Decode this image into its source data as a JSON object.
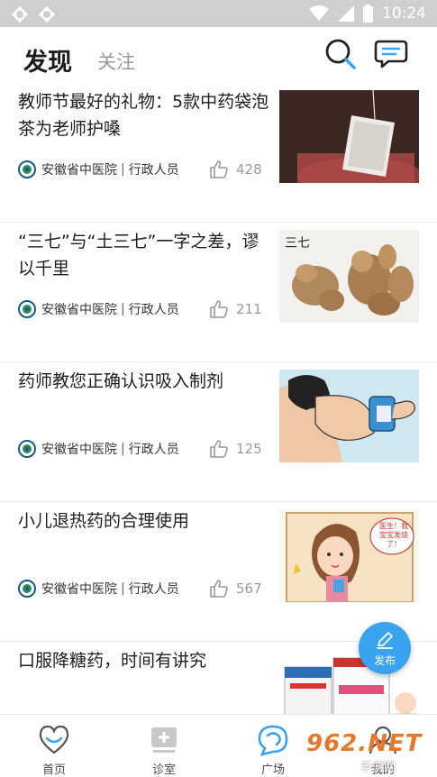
{
  "status_bar": {
    "time": "10:24"
  },
  "header": {
    "tab_discover": "发现",
    "tab_follow": "关注"
  },
  "articles": [
    {
      "title": "教师节最好的礼物：5款中药袋泡茶为老师护嗓",
      "org": "安徽省中医院",
      "role": "行政人员",
      "likes": "428"
    },
    {
      "title": "“三七”与“土三七”一字之差，谬以千里",
      "org": "安徽省中医院",
      "role": "行政人员",
      "likes": "211",
      "thumb_caption": "三七"
    },
    {
      "title": "药师教您正确认识吸入制剂",
      "org": "安徽省中医院",
      "role": "行政人员",
      "likes": "125"
    },
    {
      "title": "小儿退热药的合理使用",
      "org": "安徽省中医院",
      "role": "行政人员",
      "likes": "567",
      "thumb_caption": "医生！我宝宝发烧了！"
    },
    {
      "title": "口服降糖药，时间有讲究"
    }
  ],
  "fab": {
    "label": "发布"
  },
  "tabbar": {
    "items": [
      {
        "label": "首页",
        "icon": "heart-chat-icon"
      },
      {
        "label": "诊室",
        "icon": "clinic-plus-icon"
      },
      {
        "label": "广场",
        "icon": "plaza-chat-icon"
      },
      {
        "label": "我的",
        "icon": "profile-icon"
      }
    ]
  },
  "watermark": {
    "main": "962.NET",
    "sub": "乐游网"
  },
  "colors": {
    "accent": "#3aa3f0",
    "brand_icon": "#1a5a8a",
    "watermark": "#e8772e"
  }
}
